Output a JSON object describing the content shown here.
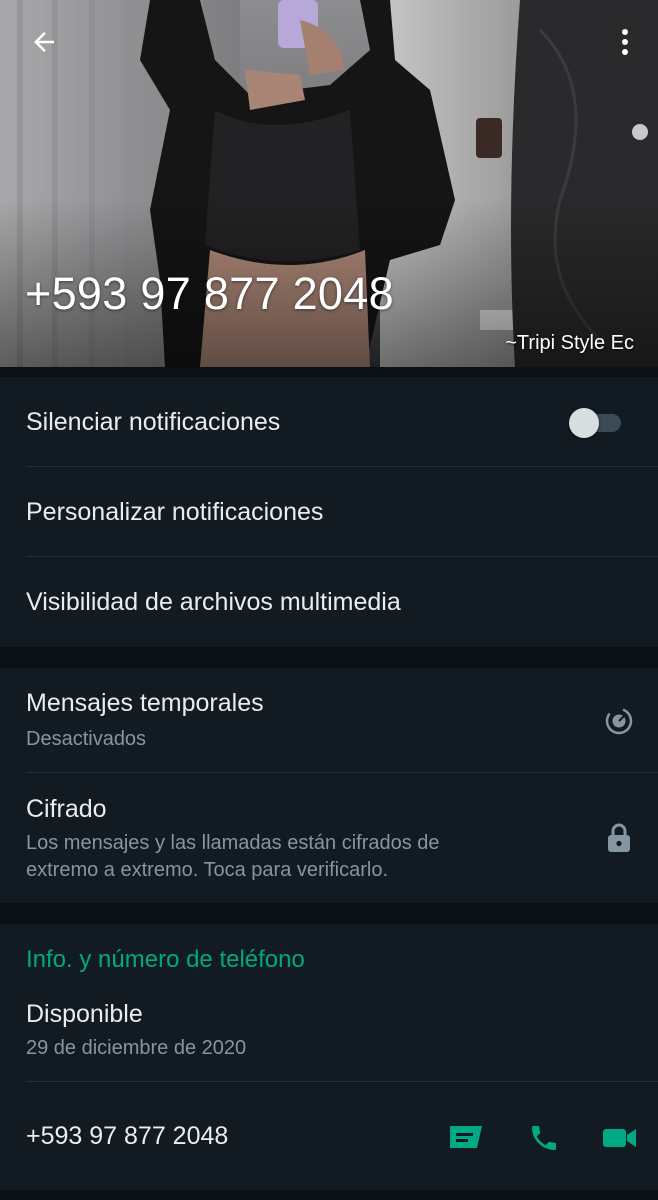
{
  "header": {
    "title": "+593 97 877 2048",
    "photo_caption": "~Tripi Style Ec"
  },
  "notifications": {
    "mute_label": "Silenciar notificaciones",
    "mute_enabled": false,
    "custom_label": "Personalizar notificaciones",
    "media_label": "Visibilidad de archivos multimedia"
  },
  "privacy": {
    "disappearing_label": "Mensajes temporales",
    "disappearing_status": "Desactivados",
    "encryption_label": "Cifrado",
    "encryption_desc_line1": "Los mensajes y las llamadas están cifrados de",
    "encryption_desc_line2": "extremo a extremo. Toca para verificarlo."
  },
  "about": {
    "section_title": "Info. y número de teléfono",
    "status": "Disponible",
    "status_date": "29 de diciembre de 2020",
    "phone": "+593 97 877 2048"
  },
  "colors": {
    "accent": "#00a884",
    "background": "#0b1014",
    "surface": "#111b21",
    "secondary_text": "#8696a0"
  },
  "icons": {
    "back": "arrow-left-icon",
    "menu": "more-vertical-icon",
    "disappearing": "timer-icon",
    "encryption": "lock-icon",
    "message": "message-icon",
    "call": "phone-icon",
    "video": "video-call-icon"
  }
}
